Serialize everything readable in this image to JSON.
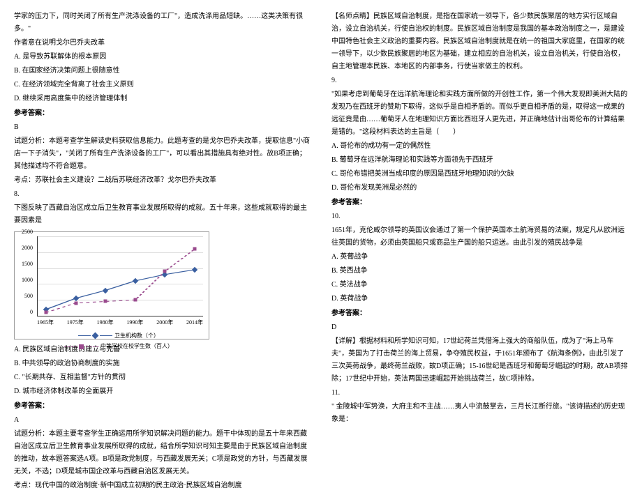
{
  "left": {
    "intro1": "学家的压力下，同时关闭了所有生产洗涤设备的工厂\"，造成洗涤用品短缺。……这类决策有很多。\"",
    "intro2": "作者意在说明戈尔巴乔夫改革",
    "optA": "A. 是导致苏联解体的根本原因",
    "optB": "B. 在国家经济决策问题上很随意性",
    "optC": "C. 在经济领域完全背离了社会主义原则",
    "optD": "D. 继续采用高度集中的经济管理体制",
    "ansLabel": "参考答案：",
    "ans": "B",
    "analysis1": "试题分析：本题考查学生解读史料获取信息能力。此题考查的是戈尔巴乔夫改革，提取信息\"小商店一下子消失\"，\"关闭了所有生产洗涤设备的工厂\"，可以看出其措施具有绝对性。故B项正确；其他描述均不符合题意。",
    "kaodian": "考点：苏联社会主义建设？二战后苏联经济改革？戈尔巴乔夫改革",
    "q8num": "8.",
    "q8text": "下图反映了西藏自治区成立后卫生教育事业发展所取得的成就。五十年来，这些成就取得的最主要因素是",
    "q8A": "A. 民族区域自治制度的建立与完善",
    "q8B": "B. 中共领导的政治协商制度的实施",
    "q8C": "C. \"长期共存、互相监督\"方针的贯彻",
    "q8D": "D. 城市经济体制改革的全面展开",
    "q8ansLabel": "参考答案：",
    "q8ans": "A",
    "q8analysis": "试题分析：本题主要考查学生正确运用所学知识解决问题的能力。题干中体现的是五十年来西藏自治区成立后卫生教育事业发展所取得的成就，结合所学知识可知主要是由于民族区域自治制度的推动，故本题答案选A项。B项是政党制度，与西藏发展无关；C项是政党的方针，与西藏发展无关，不选；D项是城市国企改革与西藏自治区发展无关。",
    "q8kaodian": "考点：现代中国的政治制度·新中国成立初期的民主政治·民族区域自治制度"
  },
  "right": {
    "mingshi": "【名师点睛】民族区域自治制度，是指在国家统一领导下，各少数民族聚居的地方实行区域自治，设立自治机关，行使自治权的制度。民族区域自治制度是我国的基本政治制度之一，是建设中国特色社会主义政治的重要内容。民族区域自治制度就是在统一的祖国大家庭里，在国家的统一领导下，以少数民族聚居的地区为基础，建立相应的自治机关，设立自治机关，行使自治权，自主地管理本民族、本地区的内部事务，行使当家做主的权利。",
    "q9num": "9.",
    "q9text1": "\"如果考虑到葡萄牙在远洋航海理论和实践方面所做的开创性工作，第一个伟大发现即美洲大陆的发现乃在西班牙的赞助下取得，这似乎是自相矛盾的。而似乎更自相矛盾的是，取得这一成果的远征竟是由……葡萄牙人在地理知识方面比西班牙人更先进，并正确地估计出哥伦布的计算结果是错的。\"这段材料表达的主旨是（　　）",
    "q9A": "A. 哥伦布的成功有一定的偶然性",
    "q9B": "B. 葡萄牙在远洋航海理论和实践等方面领先于西班牙",
    "q9C": "C. 哥伦布错把美洲当成印度的原因是西班牙地理知识的欠缺",
    "q9D": "D. 哥伦布发现美洲是必然的",
    "q9ansLabel": "参考答案：",
    "q10num": "10.",
    "q10text": "1651年，克伦威尔领导的英国议会通过了第一个保护英国本土航海贸易的法案，规定凡从欧洲运往英国的货物，必须由英国船只或商品生产国的船只运送。由此引发的殖民战争是",
    "q10A": "A. 英葡战争",
    "q10B": "B. 英西战争",
    "q10C": "C. 英法战争",
    "q10D": "D. 英荷战争",
    "q10ansLabel": "参考答案：",
    "q10ans": "D",
    "q10detail": "【详解】根据材料和所学知识可知，17世纪荷兰凭借海上强大的商船队伍，成为了\"海上马车夫\"，英国为了打击荷兰的海上贸易，争夺殖民权益，于1651年颁布了《航海条例》，由此引发了三次英荷战争，最终荷兰战败，故D项正确；15-16世纪是西班牙和葡萄牙崛起的时期，故AB项排除；17世纪中开始，英法两国迅速崛起开始挑战荷兰，故C项排除。",
    "q11num": "11.",
    "q11text": "\" 金陵城中军势涣，大府主和不主战……夷人中流鼓掌去，三月长江断行旅。\"该诗描述的历史现象是："
  },
  "chart_data": {
    "type": "line",
    "categories": [
      "1965年",
      "1975年",
      "1980年",
      "1990年",
      "2000年",
      "2014年"
    ],
    "series": [
      {
        "name": "卫生机构数（个）",
        "values": [
          200,
          550,
          800,
          1100,
          1300,
          1450
        ]
      },
      {
        "name": "中等学校在校学生数（百人）",
        "values": [
          100,
          400,
          450,
          500,
          1400,
          2100
        ]
      }
    ],
    "ylim": [
      0,
      2500
    ],
    "yticks": [
      0,
      500,
      1000,
      1500,
      2000,
      2500
    ]
  }
}
